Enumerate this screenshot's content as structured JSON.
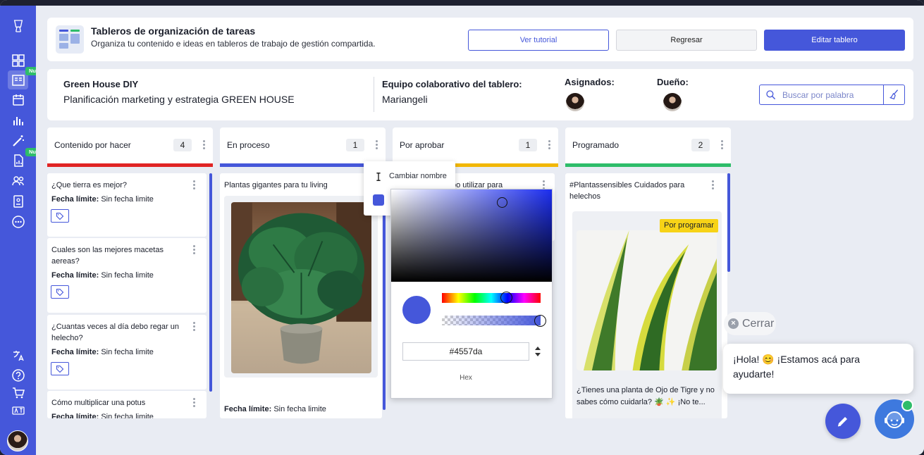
{
  "sidebar": {
    "badges": [
      "Nuevo",
      "Nuevo"
    ]
  },
  "header": {
    "title": "Tableros de organización de tareas",
    "subtitle": "Organiza tu contenido e ideas en tableros de trabajo de gestión compartida.",
    "btn_tutorial": "Ver tutorial",
    "btn_back": "Regresar",
    "btn_edit": "Editar tablero"
  },
  "board": {
    "name": "Green House DIY",
    "description": "Planificación marketing y estrategia GREEN HOUSE",
    "team_label": "Equipo colaborativo del tablero:",
    "team_value": "Mariangeli",
    "assigned_label": "Asignados:",
    "owner_label": "Dueño:",
    "search_placeholder": "Buscar por palabra"
  },
  "columns": [
    {
      "name": "Contenido por hacer",
      "count": "4",
      "color": "#e02424"
    },
    {
      "name": "En proceso",
      "count": "1",
      "color": "#4557da"
    },
    {
      "name": "Por aprobar",
      "count": "1",
      "color": "#f2b705"
    },
    {
      "name": "Programado",
      "count": "2",
      "color": "#2ebd6a"
    }
  ],
  "cards": {
    "c1": "¿Que tierra es mejor?",
    "c2": "Cuales son las mejores macetas aereas?",
    "c3": "¿Cuantas veces al día debo regar un helecho?",
    "c4": "Cómo multiplicar una potus",
    "date_label": "Fecha límite:",
    "date_value": "Sin fecha limite",
    "p1": "Plantas gigantes para tu living",
    "a1": "bo utilizar para",
    "g1": "#Plantassensibles Cuidados para helechos",
    "g1_badge": "Por programar",
    "g1_caption": "¿Tienes una planta de Ojo de Tigre y no sabes cómo cuidarla? 🪴 ✨ ¡No te..."
  },
  "popmenu": {
    "rename": "Cambiar nombre"
  },
  "picker": {
    "hex": "#4557da",
    "mode": "Hex",
    "color": "#4557da"
  },
  "chat": {
    "close": "Cerrar",
    "greeting": "¡Hola! 😊 ¡Estamos acá para ayudarte!"
  }
}
